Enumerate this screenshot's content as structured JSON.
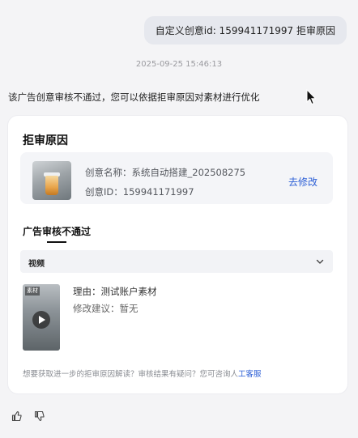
{
  "user_message": "自定义创意id: 159941171997 拒审原因",
  "timestamp": "2025-09-25 15:46:13",
  "reply_text": "该广告创意审核不通过，您可以依据拒审原因对素材进行优化",
  "card": {
    "title": "拒审原因",
    "creative_name": "创意名称：系统自动搭建_202508275",
    "creative_id": "创意ID：159941171997",
    "edit_label": "去修改",
    "section_title": "广告审核不通过",
    "type_label": "视频",
    "thumb_tag": "素材",
    "reason": "理由：测试账户素材",
    "suggestion": "修改建议：暂无",
    "footer_text": "想要获取进一步的拒审原因解读？审核结果有疑问？您可咨询人",
    "footer_link": "工客服"
  },
  "colors": {
    "accent": "#2c5fd6",
    "background": "#f4f4f6",
    "card": "#ffffff"
  },
  "icons": [
    "chevron-down-icon",
    "play-icon",
    "thumbs-up-icon",
    "thumbs-down-icon",
    "cursor-icon"
  ]
}
